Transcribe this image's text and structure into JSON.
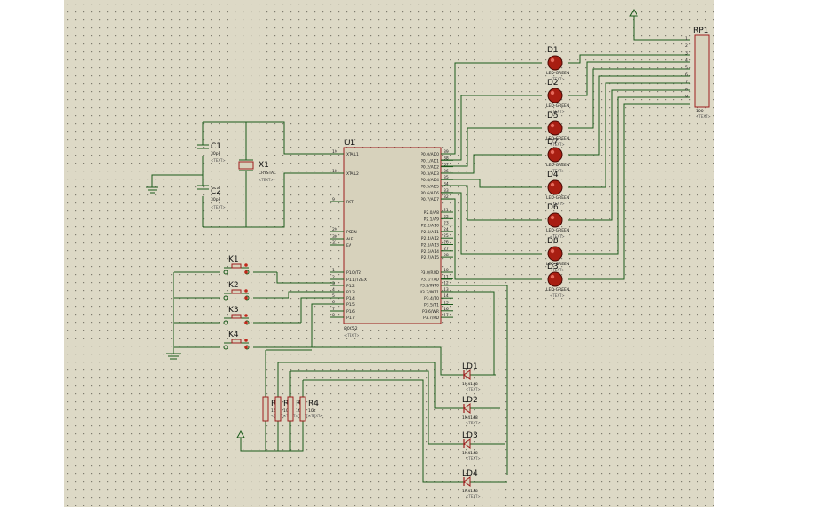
{
  "colors": {
    "sheet": "#ddd9c6",
    "wire": "#1a5a1a",
    "body": "#9e1d1d",
    "chip": "#d7d2bc",
    "led": "#a81e12"
  },
  "mcu": {
    "ref": "U1",
    "part": "80C52",
    "text": "<TEXT>",
    "left_pins": [
      [
        "XTAL1",
        "19"
      ],
      [
        "XTAL2",
        "18"
      ],
      [
        "RST",
        "9"
      ],
      [
        "PSEN",
        "29"
      ],
      [
        "ALE",
        "30"
      ],
      [
        "EA",
        "31"
      ],
      [
        "P1.0/T2",
        "1"
      ],
      [
        "P1.1/T2EX",
        "2"
      ],
      [
        "P1.2",
        "3"
      ],
      [
        "P1.3",
        "4"
      ],
      [
        "P1.4",
        "5"
      ],
      [
        "P1.5",
        "6"
      ],
      [
        "P1.6",
        "7"
      ],
      [
        "P1.7",
        "8"
      ]
    ],
    "right_pins": [
      [
        "P0.0/AD0",
        "39"
      ],
      [
        "P0.1/AD1",
        "38"
      ],
      [
        "P0.2/AD2",
        "37"
      ],
      [
        "P0.3/AD3",
        "36"
      ],
      [
        "P0.4/AD4",
        "35"
      ],
      [
        "P0.5/AD5",
        "34"
      ],
      [
        "P0.6/AD6",
        "33"
      ],
      [
        "P0.7/AD7",
        "32"
      ],
      [
        "P2.0/A8",
        "21"
      ],
      [
        "P2.1/A9",
        "22"
      ],
      [
        "P2.2/A10",
        "23"
      ],
      [
        "P2.3/A11",
        "24"
      ],
      [
        "P2.4/A12",
        "25"
      ],
      [
        "P2.5/A13",
        "26"
      ],
      [
        "P2.6/A14",
        "27"
      ],
      [
        "P2.7/A15",
        "28"
      ],
      [
        "P3.0/RXD",
        "10"
      ],
      [
        "P3.1/TXD",
        "11"
      ],
      [
        "P3.2/INT0",
        "12"
      ],
      [
        "P3.3/INT1",
        "13"
      ],
      [
        "P3.4/T0",
        "14"
      ],
      [
        "P3.5/T1",
        "15"
      ],
      [
        "P3.6/WR",
        "16"
      ],
      [
        "P3.7/RD",
        "17"
      ]
    ]
  },
  "leds": [
    {
      "ref": "D1",
      "part": "LED-GREEN"
    },
    {
      "ref": "D2",
      "part": "LED-GREEN"
    },
    {
      "ref": "D5",
      "part": "LED-GREEN"
    },
    {
      "ref": "D7",
      "part": "LED-GREEN"
    },
    {
      "ref": "D4",
      "part": "LED-GREEN"
    },
    {
      "ref": "D6",
      "part": "LED-GREEN"
    },
    {
      "ref": "D8",
      "part": "LED-GREEN"
    },
    {
      "ref": "D3",
      "part": "LED-GREEN"
    }
  ],
  "led_text": "<TEXT>",
  "rp": {
    "ref": "RP1",
    "part": "100",
    "text": "<TEXT>",
    "pins": [
      "1",
      "2",
      "3",
      "4",
      "5",
      "6",
      "7",
      "8",
      "9"
    ]
  },
  "caps": [
    {
      "ref": "C1",
      "value": "30pF",
      "text": "<TEXT>"
    },
    {
      "ref": "C2",
      "value": "30pF",
      "text": "<TEXT>"
    }
  ],
  "crystal": {
    "ref": "X1",
    "part": "CRYSTAL",
    "text": "<TEXT>"
  },
  "keys": [
    {
      "ref": "K1"
    },
    {
      "ref": "K2"
    },
    {
      "ref": "K3"
    },
    {
      "ref": "K4"
    }
  ],
  "resistors": [
    {
      "ref": "R1",
      "value": "10k"
    },
    {
      "ref": "R2",
      "value": "10k"
    },
    {
      "ref": "R3",
      "value": "10k"
    },
    {
      "ref": "R4",
      "value": "10k"
    }
  ],
  "res_text": "<TEXT>",
  "diodes": [
    {
      "ref": "LD1",
      "part": "1N4148"
    },
    {
      "ref": "LD2",
      "part": "1N4148"
    },
    {
      "ref": "LD3",
      "part": "1N4148"
    },
    {
      "ref": "LD4",
      "part": "1N4148"
    }
  ],
  "diode_text": "<TEXT>"
}
